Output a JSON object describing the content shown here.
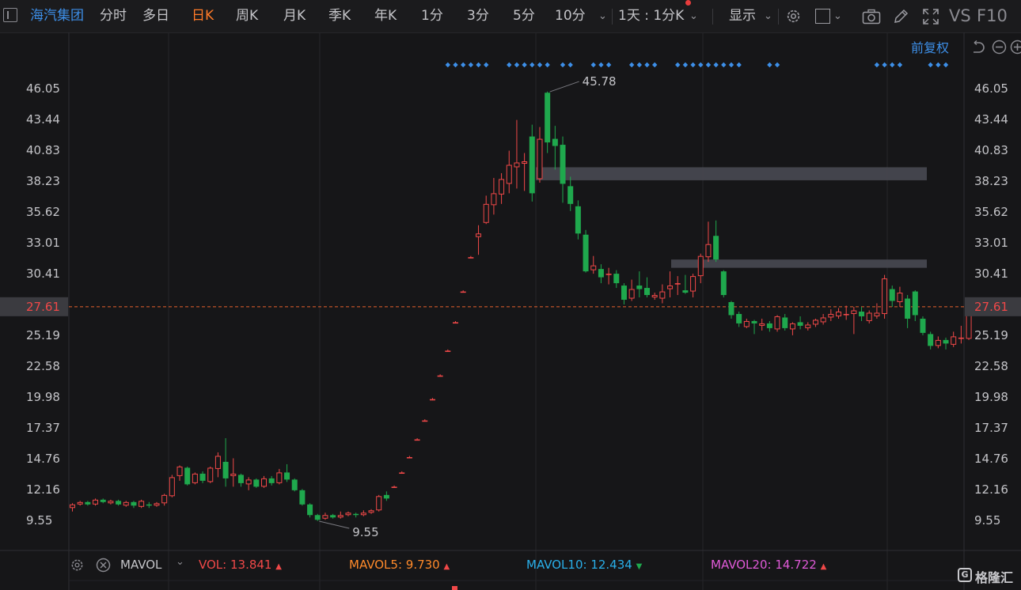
{
  "toolbar": {
    "stock_name": "海汽集团",
    "periods": [
      "分时",
      "多日",
      "日K",
      "周K",
      "月K",
      "季K",
      "年K",
      "1分",
      "3分",
      "5分",
      "10分"
    ],
    "active_period": "日K",
    "period_select": "1天 : 1分K",
    "display_label": "显示",
    "vs_label": "VS",
    "f10_label": "F10"
  },
  "adjust_label": "前复权",
  "colors": {
    "up": "#f04848",
    "down": "#1fa84d",
    "background": "#161618",
    "grid": "#26262a",
    "dots": "#3d8fe8",
    "price_line": "#e8602c"
  },
  "chart_data": {
    "type": "candlestick",
    "yticks": [
      "46.05",
      "43.44",
      "40.83",
      "38.23",
      "35.62",
      "33.01",
      "30.41",
      "27.61",
      "25.19",
      "22.58",
      "19.98",
      "17.37",
      "14.76",
      "12.16",
      "9.55"
    ],
    "ylim": [
      7.5,
      48.5
    ],
    "current_price": "27.61",
    "max_label": "45.78",
    "min_label": "9.55",
    "max_value": 45.78,
    "min_value": 9.55,
    "candles": [
      [
        10.6,
        10.9,
        10.3,
        11.0
      ],
      [
        10.9,
        11.1,
        10.8,
        11.2
      ],
      [
        11.1,
        10.9,
        10.8,
        11.2
      ],
      [
        10.9,
        11.3,
        10.8,
        11.4
      ],
      [
        11.3,
        11.1,
        11.0,
        11.4
      ],
      [
        11.0,
        11.2,
        10.9,
        11.3
      ],
      [
        11.2,
        10.9,
        10.8,
        11.3
      ],
      [
        10.8,
        11.1,
        10.7,
        11.2
      ],
      [
        11.1,
        10.8,
        10.6,
        11.2
      ],
      [
        10.7,
        11.2,
        10.6,
        11.3
      ],
      [
        10.9,
        10.8,
        10.6,
        11.1
      ],
      [
        10.8,
        11.0,
        10.7,
        11.1
      ],
      [
        11.0,
        11.7,
        10.8,
        11.8
      ],
      [
        11.6,
        13.2,
        11.5,
        13.4
      ],
      [
        13.3,
        14.1,
        12.9,
        14.2
      ],
      [
        14.0,
        12.6,
        12.5,
        14.1
      ],
      [
        12.7,
        13.5,
        12.6,
        13.6
      ],
      [
        13.5,
        12.9,
        12.7,
        13.7
      ],
      [
        12.8,
        14.0,
        12.7,
        14.1
      ],
      [
        13.9,
        15.0,
        13.2,
        15.3
      ],
      [
        14.5,
        13.1,
        12.4,
        16.5
      ],
      [
        13.3,
        13.5,
        12.4,
        14.8
      ],
      [
        13.4,
        12.7,
        12.4,
        13.5
      ],
      [
        12.6,
        13.0,
        12.1,
        13.2
      ],
      [
        13.0,
        12.4,
        12.3,
        13.1
      ],
      [
        12.4,
        13.1,
        12.3,
        13.3
      ],
      [
        13.1,
        12.7,
        12.5,
        13.3
      ],
      [
        12.7,
        13.6,
        12.6,
        13.9
      ],
      [
        13.6,
        13.0,
        12.8,
        14.3
      ],
      [
        13.0,
        12.1,
        12.0,
        13.1
      ],
      [
        12.1,
        10.9,
        10.8,
        12.2
      ],
      [
        10.9,
        10.0,
        9.8,
        11.0
      ],
      [
        10.0,
        9.6,
        9.5,
        10.1
      ],
      [
        9.7,
        10.0,
        9.6,
        10.2
      ],
      [
        10.0,
        9.8,
        9.7,
        10.1
      ],
      [
        9.8,
        10.0,
        9.7,
        10.3
      ],
      [
        10.0,
        10.2,
        9.9,
        10.3
      ],
      [
        10.1,
        10.0,
        9.8,
        10.2
      ],
      [
        10.0,
        10.2,
        9.9,
        10.4
      ],
      [
        10.2,
        10.4,
        10.1,
        10.5
      ],
      [
        10.4,
        11.6,
        10.3,
        11.7
      ],
      [
        11.7,
        11.4,
        11.2,
        12.0
      ],
      [
        12.4,
        12.4,
        12.3,
        12.5
      ],
      [
        13.6,
        13.6,
        13.5,
        13.7
      ],
      [
        14.9,
        14.9,
        14.8,
        15.0
      ],
      [
        16.4,
        16.4,
        16.3,
        16.5
      ],
      [
        18.0,
        18.0,
        17.9,
        18.1
      ],
      [
        19.8,
        19.8,
        19.7,
        19.9
      ],
      [
        21.8,
        21.8,
        21.7,
        21.9
      ],
      [
        23.9,
        23.9,
        23.8,
        24.0
      ],
      [
        26.3,
        26.3,
        26.2,
        26.4
      ],
      [
        28.9,
        28.9,
        28.8,
        29.0
      ],
      [
        31.8,
        31.8,
        31.7,
        31.9
      ],
      [
        33.5,
        33.8,
        32.0,
        34.5
      ],
      [
        34.7,
        36.3,
        34.6,
        37.0
      ],
      [
        36.2,
        37.2,
        35.4,
        38.5
      ],
      [
        37.1,
        38.4,
        36.3,
        38.9
      ],
      [
        38.0,
        39.6,
        37.2,
        40.8
      ],
      [
        39.4,
        39.8,
        37.6,
        43.4
      ],
      [
        39.7,
        39.9,
        37.4,
        40.6
      ],
      [
        42.0,
        37.2,
        36.5,
        43.0
      ],
      [
        38.4,
        41.8,
        38.1,
        42.8
      ],
      [
        45.7,
        41.5,
        40.6,
        45.8
      ],
      [
        41.8,
        41.2,
        39.2,
        42.9
      ],
      [
        41.3,
        38.0,
        36.4,
        42.0
      ],
      [
        37.8,
        36.3,
        35.7,
        38.6
      ],
      [
        36.1,
        33.8,
        33.3,
        36.6
      ],
      [
        33.7,
        30.6,
        30.5,
        34.1
      ],
      [
        30.7,
        31.1,
        30.4,
        31.9
      ],
      [
        30.8,
        30.1,
        29.6,
        31.2
      ],
      [
        30.3,
        30.4,
        29.5,
        30.9
      ],
      [
        30.4,
        29.6,
        29.2,
        30.7
      ],
      [
        29.4,
        28.2,
        27.8,
        29.6
      ],
      [
        28.3,
        29.1,
        28.1,
        29.9
      ],
      [
        29.4,
        29.1,
        28.4,
        30.6
      ],
      [
        29.2,
        28.6,
        28.4,
        30.1
      ],
      [
        28.4,
        28.6,
        28.2,
        28.8
      ],
      [
        28.3,
        28.9,
        27.9,
        29.5
      ],
      [
        29.1,
        29.4,
        28.4,
        30.6
      ],
      [
        29.5,
        29.6,
        28.6,
        30.2
      ],
      [
        29.0,
        28.8,
        28.7,
        30.3
      ],
      [
        28.9,
        30.2,
        28.4,
        30.4
      ],
      [
        30.2,
        31.9,
        29.6,
        32.1
      ],
      [
        31.8,
        32.9,
        31.4,
        34.8
      ],
      [
        33.6,
        31.6,
        31.4,
        34.9
      ],
      [
        30.6,
        28.6,
        28.4,
        30.7
      ],
      [
        28.0,
        26.9,
        26.6,
        28.1
      ],
      [
        27.0,
        26.2,
        25.9,
        27.2
      ],
      [
        25.9,
        26.4,
        25.8,
        26.6
      ],
      [
        26.4,
        26.2,
        25.3,
        26.5
      ],
      [
        26.0,
        26.2,
        25.6,
        26.6
      ],
      [
        26.2,
        25.8,
        25.5,
        26.4
      ],
      [
        25.7,
        26.8,
        25.5,
        26.9
      ],
      [
        26.7,
        25.8,
        25.6,
        27.0
      ],
      [
        25.7,
        26.2,
        25.2,
        26.3
      ],
      [
        26.3,
        26.0,
        25.7,
        26.8
      ],
      [
        25.8,
        26.1,
        25.6,
        26.3
      ],
      [
        26.1,
        26.5,
        25.9,
        26.6
      ],
      [
        26.3,
        26.7,
        26.1,
        27.0
      ],
      [
        26.7,
        27.0,
        26.4,
        27.4
      ],
      [
        26.8,
        27.2,
        26.6,
        27.5
      ],
      [
        26.9,
        27.0,
        26.5,
        27.7
      ],
      [
        27.0,
        27.3,
        25.3,
        27.6
      ],
      [
        27.2,
        26.8,
        26.4,
        27.6
      ],
      [
        26.4,
        27.1,
        26.2,
        27.3
      ],
      [
        26.8,
        27.1,
        26.6,
        27.9
      ],
      [
        27.0,
        30.0,
        26.6,
        30.3
      ],
      [
        29.1,
        28.1,
        27.6,
        29.4
      ],
      [
        28.0,
        28.8,
        27.6,
        29.3
      ],
      [
        28.3,
        26.6,
        25.8,
        28.6
      ],
      [
        28.9,
        26.9,
        26.4,
        29.0
      ],
      [
        26.6,
        25.4,
        25.2,
        26.8
      ],
      [
        25.3,
        24.3,
        24.0,
        25.5
      ],
      [
        24.3,
        24.8,
        24.1,
        25.1
      ],
      [
        24.8,
        24.5,
        24.0,
        25.0
      ],
      [
        24.4,
        25.1,
        24.2,
        25.5
      ],
      [
        25.0,
        25.0,
        24.5,
        26.0
      ],
      [
        24.9,
        27.7,
        24.8,
        27.8
      ]
    ],
    "signal_dot_groups": [
      [
        49,
        54
      ],
      [
        57,
        62
      ],
      [
        64,
        65
      ],
      [
        68,
        70
      ],
      [
        73,
        76
      ],
      [
        79,
        87
      ],
      [
        91,
        92
      ],
      [
        105,
        108
      ],
      [
        112,
        114
      ]
    ],
    "resistance_zones": [
      [
        38.3,
        39.4
      ],
      [
        30.9,
        31.6
      ]
    ],
    "volume_legend": {
      "indicator": "MAVOL",
      "vol": {
        "label": "VOL: ",
        "value": "13.841",
        "color": "#f04848"
      },
      "mavol5": {
        "label": "MAVOL5: ",
        "value": "9.730",
        "color": "#ff8a2a"
      },
      "mavol10": {
        "label": "MAVOL10: ",
        "value": "12.434",
        "color": "#29aee8"
      },
      "mavol20": {
        "label": "MAVOL20: ",
        "value": "14.722",
        "color": "#e05ad8"
      }
    }
  },
  "watermark": "格隆汇"
}
